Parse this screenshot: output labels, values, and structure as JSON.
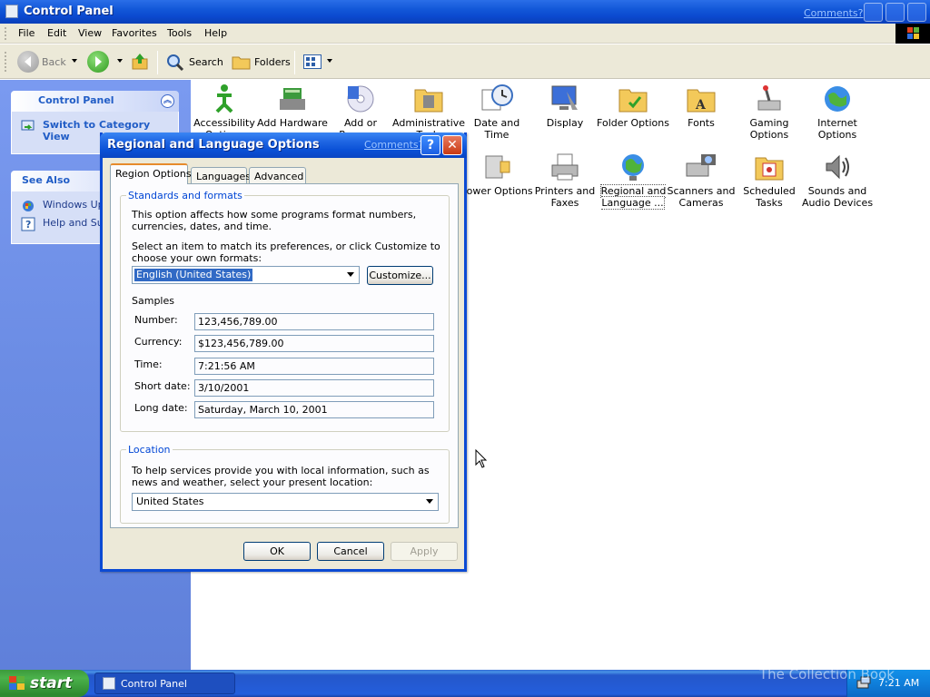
{
  "window": {
    "title": "Control Panel",
    "comments": "Comments?"
  },
  "menu": [
    "File",
    "Edit",
    "View",
    "Favorites",
    "Tools",
    "Help"
  ],
  "toolbar": {
    "back": "Back",
    "search": "Search",
    "folders": "Folders"
  },
  "left_pane": {
    "control_panel": {
      "title": "Control Panel",
      "switch_view": "Switch to Category View"
    },
    "see_also": {
      "title": "See Also",
      "items": [
        "Windows Upd",
        "Help and Sup"
      ]
    }
  },
  "icons": [
    {
      "label": "Accessibility Options"
    },
    {
      "label": "Add Hardware"
    },
    {
      "label": "Add or Remov..."
    },
    {
      "label": "Administrative Tools"
    },
    {
      "label": "Date and Time"
    },
    {
      "label": "Display"
    },
    {
      "label": "Folder Options"
    },
    {
      "label": "Fonts"
    },
    {
      "label": "Gaming Options"
    },
    {
      "label": "Internet Options"
    },
    {
      "label": "Power Options"
    },
    {
      "label": "Printers and Faxes"
    },
    {
      "label": "Regional and Language ..."
    },
    {
      "label": "Scanners and Cameras"
    },
    {
      "label": "Scheduled Tasks"
    },
    {
      "label": "Sounds and Audio Devices"
    }
  ],
  "dialog": {
    "title": "Regional and Language Options",
    "comments": "Comments?",
    "help": "?",
    "tabs": [
      "Region Options",
      "Languages",
      "Advanced"
    ],
    "standards": {
      "title": "Standards and formats",
      "desc": "This option affects how some programs format numbers, currencies, dates, and time.",
      "select_desc": "Select an item to match its preferences, or click Customize to choose your own formats:",
      "format": "English (United States)",
      "customize": "Customize...",
      "samples_title": "Samples",
      "samples": [
        {
          "label": "Number:",
          "value": "123,456,789.00"
        },
        {
          "label": "Currency:",
          "value": "$123,456,789.00"
        },
        {
          "label": "Time:",
          "value": "7:21:56 AM"
        },
        {
          "label": "Short date:",
          "value": "3/10/2001"
        },
        {
          "label": "Long date:",
          "value": "Saturday, March 10, 2001"
        }
      ]
    },
    "location": {
      "title": "Location",
      "desc": "To help services provide you with local information, such as news and weather, select your present location:",
      "value": "United States"
    },
    "buttons": {
      "ok": "OK",
      "cancel": "Cancel",
      "apply": "Apply"
    }
  },
  "taskbar": {
    "start": "start",
    "task": "Control Panel",
    "clock": "7:21 AM",
    "watermark": "The Collection Book"
  }
}
